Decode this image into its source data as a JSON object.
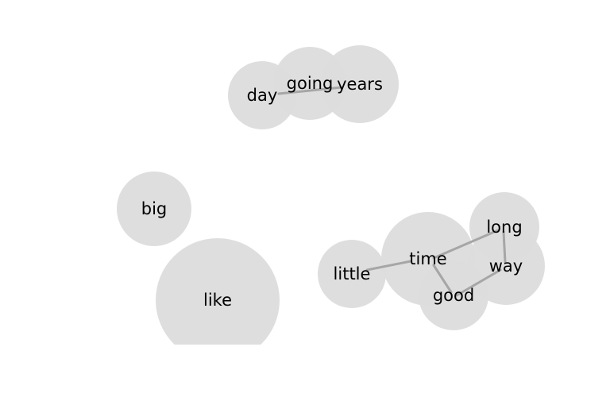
{
  "graph": {
    "colors": {
      "node_fill": "#dcdcdc",
      "edge_stroke": "#a6a6a6",
      "label_text": "#000000",
      "background": "#ffffff"
    },
    "nodes": [
      {
        "id": "day",
        "label": "day"
      },
      {
        "id": "going",
        "label": "going"
      },
      {
        "id": "years",
        "label": "years"
      },
      {
        "id": "big",
        "label": "big"
      },
      {
        "id": "like",
        "label": "like"
      },
      {
        "id": "little",
        "label": "little"
      },
      {
        "id": "time",
        "label": "time"
      },
      {
        "id": "long",
        "label": "long"
      },
      {
        "id": "way",
        "label": "way"
      },
      {
        "id": "good",
        "label": "good"
      }
    ],
    "edges": [
      {
        "source": "day",
        "target": "years"
      },
      {
        "source": "little",
        "target": "time"
      },
      {
        "source": "time",
        "target": "long"
      },
      {
        "source": "time",
        "target": "good"
      },
      {
        "source": "long",
        "target": "way"
      },
      {
        "source": "way",
        "target": "good"
      }
    ]
  }
}
